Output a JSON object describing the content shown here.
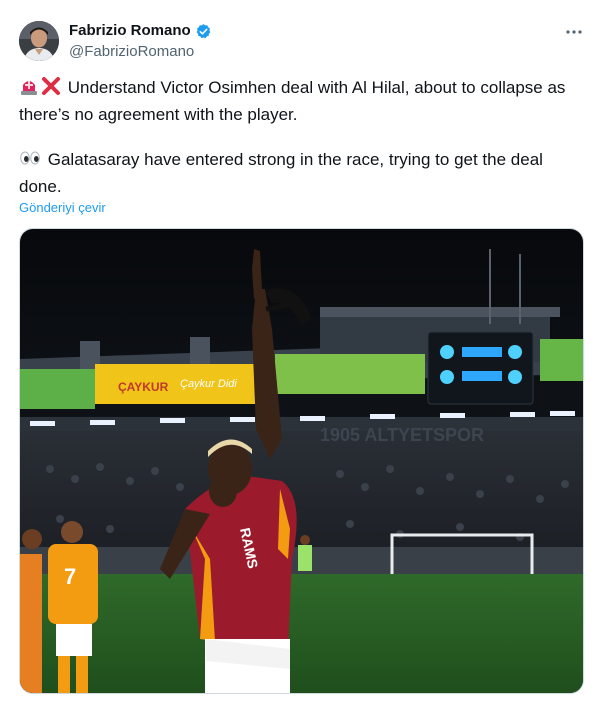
{
  "author": {
    "name": "Fabrizio Romano",
    "handle": "@FabrizioRomano",
    "verified": true
  },
  "icons": {
    "verified": "verified-badge-icon",
    "more": "more-options-icon",
    "siren": "police-light-emoji",
    "cross": "cross-mark-emoji",
    "eyes": "eyes-emoji"
  },
  "tweet": {
    "paragraph1": "Understand Victor Osimhen deal with Al Hilal, about to collapse as there’s no agreement with the player.",
    "paragraph2": "Galatasaray have entered strong in the race, trying to get the deal done.",
    "translate_label": "Gönderiyi çevir"
  },
  "media": {
    "board_text_1": "ÇAYKUR",
    "board_text_2": "Çaykur Didi",
    "stand_text": "1905 ALTYETSPOR",
    "shirt_text": "RAMS",
    "player_number": "7"
  },
  "colors": {
    "accent": "#1d9bf0",
    "text_primary": "#0f1419",
    "text_secondary": "#536471",
    "siren_red": "#e0245e",
    "cross_red": "#dd2e44",
    "galatasaray_red": "#9b1b2c",
    "galatasaray_orange": "#f39c12"
  }
}
